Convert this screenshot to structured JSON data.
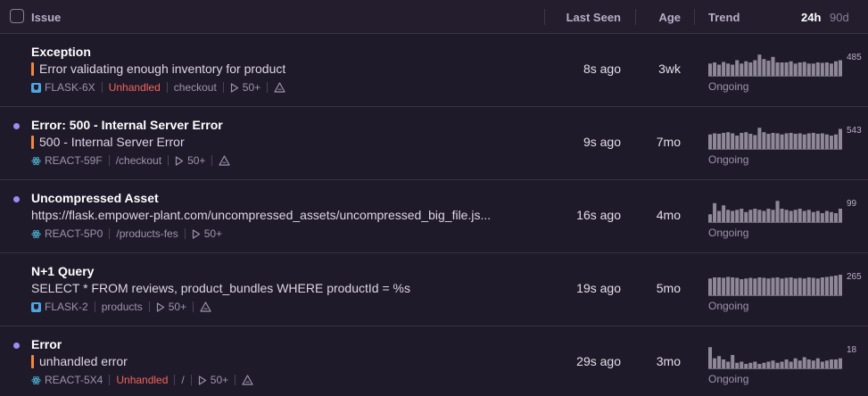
{
  "header": {
    "issue": "Issue",
    "last_seen": "Last Seen",
    "age": "Age",
    "trend": "Trend",
    "period_active": "24h",
    "period_inactive": "90d"
  },
  "colors": {
    "accent_unread": "#9e8cf5",
    "level_bar": "#f2873e",
    "unhandled": "#f2645c",
    "sparkline": "#8f8899"
  },
  "issues": [
    {
      "title": "Exception",
      "message": "Error validating enough inventory for product",
      "platform_icon": "flask-icon",
      "short_id": "FLASK-6X",
      "unhandled": "Unhandled",
      "culprit": "checkout",
      "events": "50+",
      "last_seen": "8s ago",
      "age": "3wk",
      "trend_max": "485",
      "status": "Ongoing",
      "trend": [
        0.55,
        0.6,
        0.5,
        0.62,
        0.55,
        0.5,
        0.7,
        0.55,
        0.65,
        0.6,
        0.7,
        0.95,
        0.75,
        0.68,
        0.85,
        0.6,
        0.6,
        0.6,
        0.65,
        0.55,
        0.6,
        0.62,
        0.55,
        0.55,
        0.6,
        0.58,
        0.6,
        0.55,
        0.65,
        0.7
      ]
    },
    {
      "title": "Error: 500 - Internal Server Error",
      "message": "500 - Internal Server Error",
      "platform_icon": "react-icon",
      "short_id": "REACT-59F",
      "culprit": "/checkout",
      "events": "50+",
      "last_seen": "9s ago",
      "age": "7mo",
      "trend_max": "543",
      "status": "Ongoing",
      "trend": [
        0.65,
        0.7,
        0.68,
        0.72,
        0.75,
        0.7,
        0.6,
        0.72,
        0.75,
        0.68,
        0.62,
        0.95,
        0.75,
        0.68,
        0.72,
        0.7,
        0.65,
        0.7,
        0.72,
        0.68,
        0.7,
        0.65,
        0.7,
        0.72,
        0.68,
        0.7,
        0.65,
        0.6,
        0.65,
        0.9
      ]
    },
    {
      "title": "Uncompressed Asset",
      "message": "https://flask.empower-plant.com/uncompressed_assets/uncompressed_big_file.js...",
      "platform_icon": "react-icon",
      "short_id": "REACT-5P0",
      "culprit": "/products-fes",
      "events": "50+",
      "last_seen": "16s ago",
      "age": "4mo",
      "trend_max": "99",
      "status": "Ongoing",
      "trend": [
        0.35,
        0.85,
        0.5,
        0.75,
        0.55,
        0.5,
        0.55,
        0.6,
        0.45,
        0.55,
        0.6,
        0.55,
        0.5,
        0.6,
        0.55,
        0.95,
        0.6,
        0.55,
        0.5,
        0.55,
        0.6,
        0.5,
        0.55,
        0.45,
        0.5,
        0.4,
        0.5,
        0.45,
        0.4,
        0.6
      ]
    },
    {
      "title": "N+1 Query",
      "message": "SELECT * FROM reviews, product_bundles WHERE productId = %s",
      "platform_icon": "flask-icon",
      "short_id": "FLASK-2",
      "culprit": "products",
      "events": "50+",
      "last_seen": "19s ago",
      "age": "5mo",
      "trend_max": "265",
      "status": "Ongoing",
      "trend": [
        0.75,
        0.8,
        0.8,
        0.78,
        0.82,
        0.8,
        0.78,
        0.72,
        0.75,
        0.78,
        0.75,
        0.8,
        0.78,
        0.75,
        0.78,
        0.8,
        0.75,
        0.78,
        0.8,
        0.75,
        0.78,
        0.75,
        0.8,
        0.78,
        0.75,
        0.8,
        0.82,
        0.85,
        0.88,
        0.92
      ]
    },
    {
      "title": "Error",
      "message": "unhandled error",
      "platform_icon": "react-icon",
      "short_id": "REACT-5X4",
      "unhandled": "Unhandled",
      "culprit": "/",
      "events": "50+",
      "last_seen": "29s ago",
      "age": "3mo",
      "trend_max": "18",
      "status": "Ongoing",
      "trend": [
        0.95,
        0.45,
        0.55,
        0.4,
        0.3,
        0.6,
        0.25,
        0.3,
        0.2,
        0.25,
        0.3,
        0.2,
        0.25,
        0.3,
        0.35,
        0.25,
        0.3,
        0.4,
        0.3,
        0.45,
        0.35,
        0.5,
        0.4,
        0.35,
        0.45,
        0.3,
        0.35,
        0.4,
        0.4,
        0.45
      ]
    }
  ]
}
